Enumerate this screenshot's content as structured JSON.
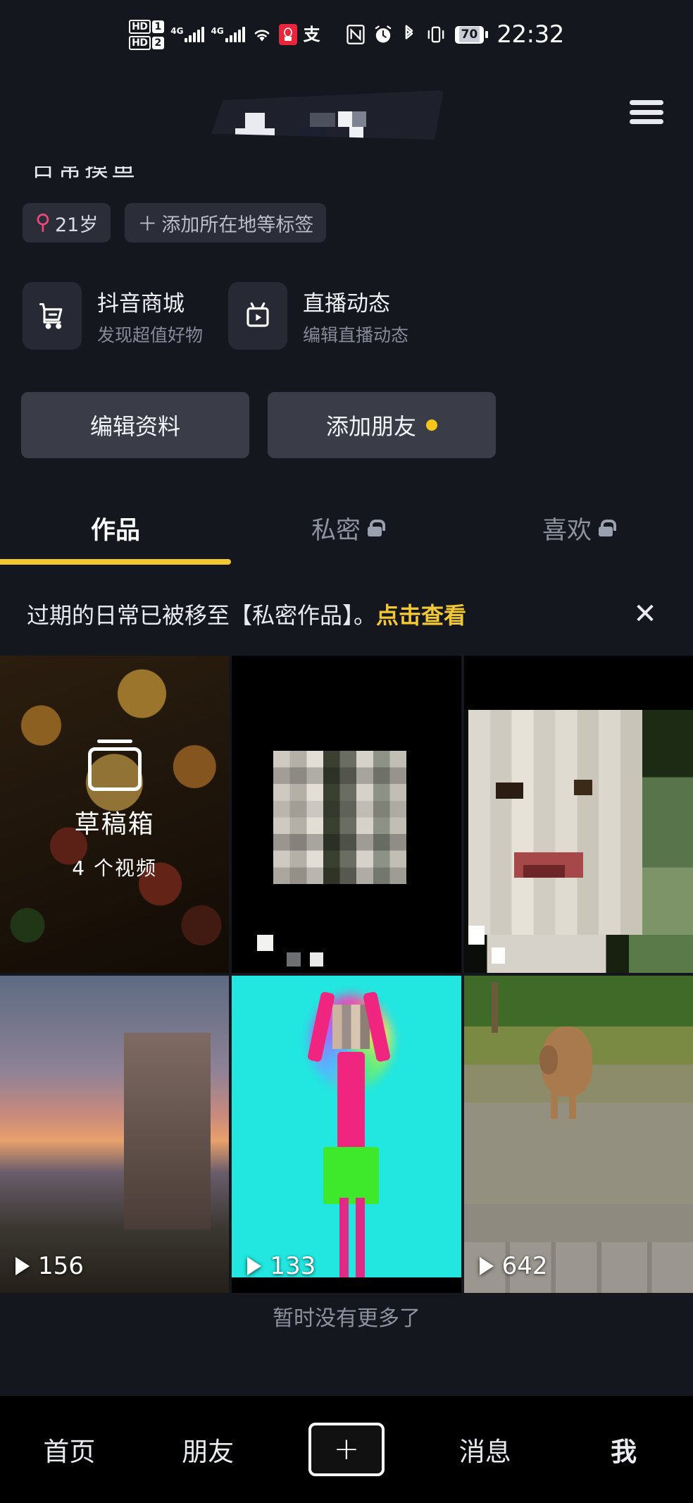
{
  "status_bar": {
    "hd1": "HD",
    "hd1_num": "1",
    "hd2": "HD",
    "hd2_num": "2",
    "net1": "4G",
    "net2": "4G",
    "alipay_glyph": "支",
    "nfc_glyph": "N",
    "battery": "70",
    "time": "22:32"
  },
  "header": {
    "title_censored": "",
    "menu_label": "menu"
  },
  "profile": {
    "nickname_cut": "日常摸鱼",
    "tags": [
      {
        "icon": "female-symbol",
        "label": "21岁"
      },
      {
        "icon": "plus",
        "label": "添加所在地等标签"
      }
    ]
  },
  "entries": [
    {
      "icon": "cart-icon",
      "title": "抖音商城",
      "subtitle": "发现超值好物"
    },
    {
      "icon": "live-tv-icon",
      "title": "直播动态",
      "subtitle": "编辑直播动态"
    }
  ],
  "actions": [
    {
      "label": "编辑资料",
      "dot": false
    },
    {
      "label": "添加朋友",
      "dot": true
    }
  ],
  "tabs": [
    {
      "label": "作品",
      "locked": false,
      "active": true
    },
    {
      "label": "私密",
      "locked": true,
      "active": false
    },
    {
      "label": "喜欢",
      "locked": true,
      "active": false
    }
  ],
  "banner": {
    "text": "过期的日常已被移至【私密作品】。",
    "link": "点击查看",
    "close": "✕"
  },
  "grid": [
    {
      "art": "art-food",
      "draft": true,
      "draft_title": "草稿箱",
      "draft_sub": "4 个视频",
      "playcount": "",
      "selected": false
    },
    {
      "art": "art-black",
      "draft": false,
      "playcount": "",
      "selected": false
    },
    {
      "art": "art-face",
      "draft": false,
      "playcount": "",
      "selected": false
    },
    {
      "art": "art-sky",
      "draft": false,
      "playcount": "156",
      "selected": false
    },
    {
      "art": "art-cyan",
      "draft": false,
      "playcount": "133",
      "selected": false
    },
    {
      "art": "art-dog",
      "draft": false,
      "playcount": "642",
      "selected": true
    }
  ],
  "footer": {
    "no_more": "暂时没有更多了",
    "nav": [
      {
        "label": "首页"
      },
      {
        "label": "朋友"
      },
      {
        "label": "+"
      },
      {
        "label": "消息"
      },
      {
        "label": "我"
      }
    ]
  },
  "colors": {
    "accent_yellow": "#f2c832",
    "selection_red": "#ff1a00",
    "female_pink": "#f04a7d",
    "background": "#15171f"
  }
}
